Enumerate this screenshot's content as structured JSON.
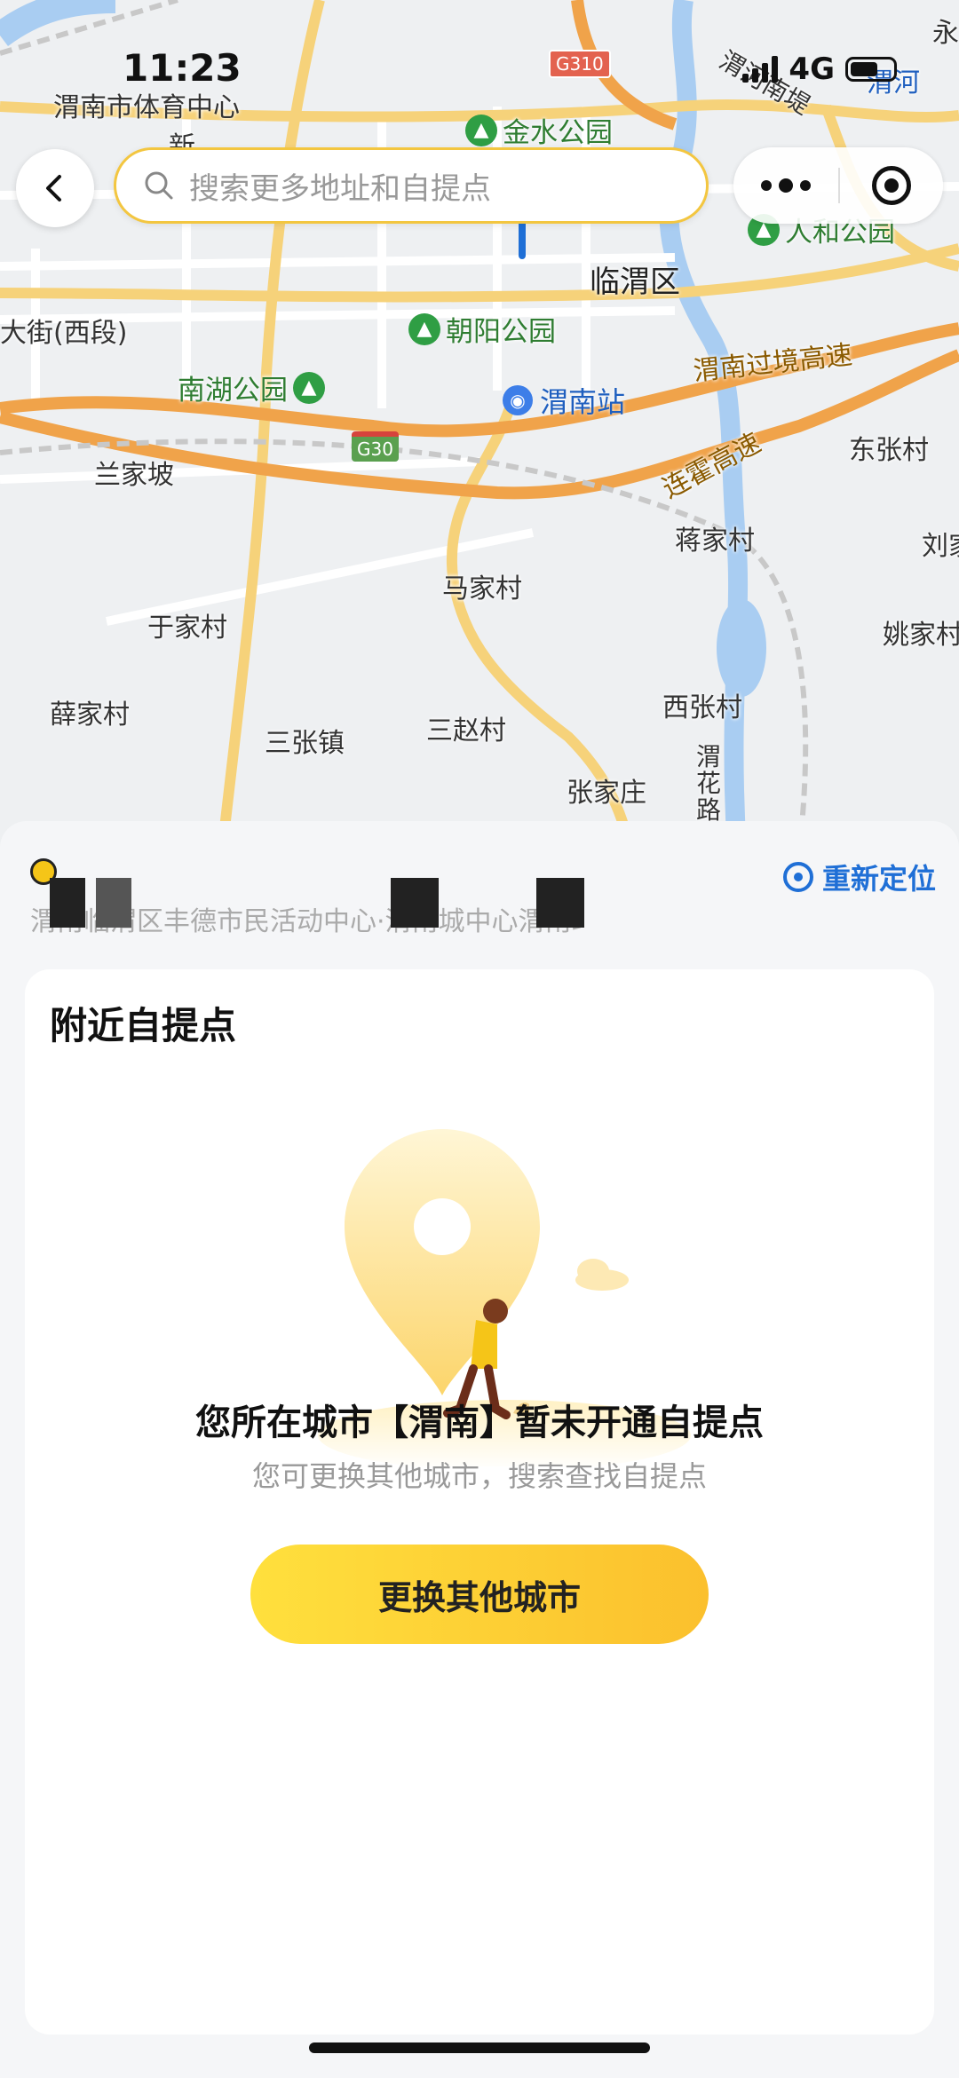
{
  "status_bar": {
    "time": "11:23",
    "network": "4G"
  },
  "search": {
    "placeholder": "搜索更多地址和自提点"
  },
  "map": {
    "labels": {
      "sports_center": "渭南市体育中心",
      "xin": "新",
      "linwei": "临渭区",
      "dajie": "大街(西段)",
      "lanjiapo": "兰家坡",
      "dongzhangcun": "东张村",
      "jiangjiacun": "蒋家村",
      "liu": "刘家",
      "majiacun": "马家村",
      "yujiacun": "于家村",
      "yaojiacun": "姚家村",
      "xuejiacun": "薛家村",
      "sanzhangzhen": "三张镇",
      "sanzhaocun": "三赵村",
      "xizhangcun": "西张村",
      "zhangjiazhuang": "张家庄",
      "weihe": "渭河",
      "weinanti": "渭河南堤",
      "yong": "永",
      "weihua": "渭花路"
    },
    "parks": {
      "jinshui": "金水公园",
      "renhe": "人和公园",
      "chaoyang": "朝阳公园",
      "nanhu": "南湖公园"
    },
    "roads": {
      "guojing": "渭南过境高速",
      "lianhuo": "连霍高速",
      "g30": "G30",
      "g310": "G310"
    },
    "station": "渭南站"
  },
  "location": {
    "address": "渭南临渭区丰德市民活动中心·渭南城中心渭南站",
    "relocate_label": "重新定位"
  },
  "nearby": {
    "title": "附近自提点",
    "empty_title": "您所在城市【渭南】暂未开通自提点",
    "empty_subtitle": "您可更换其他城市，搜索查找自提点",
    "change_city_label": "更换其他城市"
  },
  "colors": {
    "accent": "#fbc02d",
    "link": "#1f6fd6",
    "search_border": "#f3c640"
  }
}
